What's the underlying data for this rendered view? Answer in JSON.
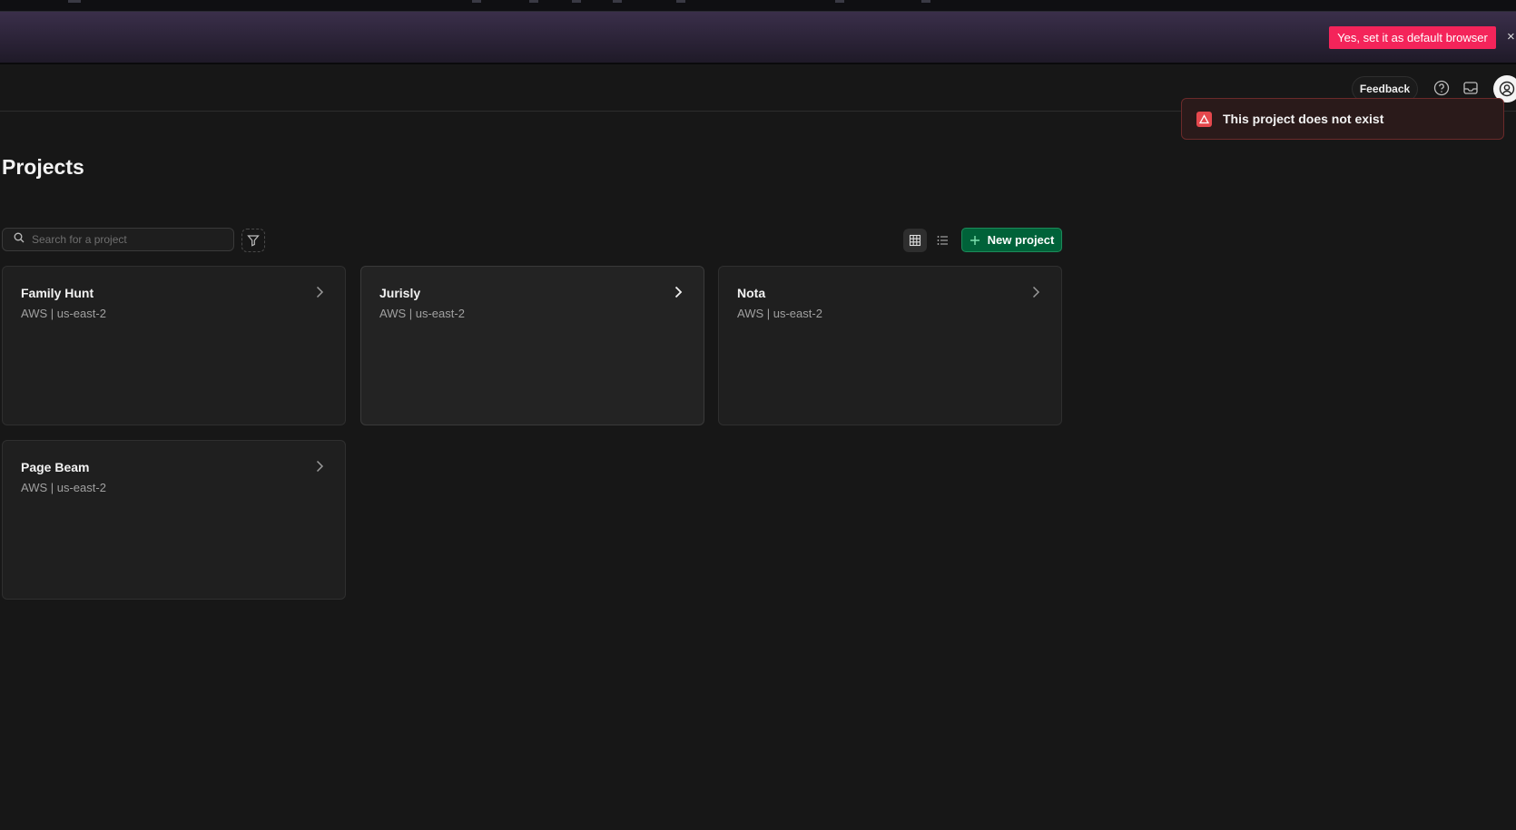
{
  "banner": {
    "button_label": "Yes, set it as default browser",
    "close_glyph": "×"
  },
  "header": {
    "feedback_label": "Feedback",
    "icons": [
      "help-icon",
      "inbox-icon",
      "user-avatar"
    ]
  },
  "toast": {
    "message": "This project does not exist",
    "color": "#e5484d"
  },
  "page": {
    "title": "Projects"
  },
  "toolbar": {
    "search_placeholder": "Search for a project",
    "new_project_label": "New project",
    "accent": "#006239"
  },
  "projects": [
    {
      "name": "Family Hunt",
      "sub": "AWS | us-east-2"
    },
    {
      "name": "Jurisly",
      "sub": "AWS | us-east-2"
    },
    {
      "name": "Nota",
      "sub": "AWS | us-east-2"
    },
    {
      "name": "Page Beam",
      "sub": "AWS | us-east-2"
    }
  ]
}
